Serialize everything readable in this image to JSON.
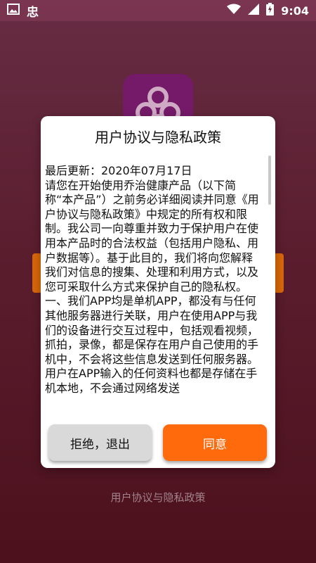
{
  "status_bar": {
    "time": "9:04",
    "carrier_glyph": "忠"
  },
  "background": {
    "bottom_link": "用户协议与隐私政策"
  },
  "dialog": {
    "title": "用户协议与隐私政策",
    "paragraphs": [
      "最后更新：2020年07月17日",
      "请您在开始使用乔治健康产品（以下简称“本产品”）之前务必详细阅读并同意《用户协议与隐私政策》中规定的所有权和限制。我公司一向尊重并致力于保护用户在使用本产品时的合法权益（包括用户隐私、用户数据等）。基于此目的，我们将向您解释我们对信息的搜集、处理和利用方式，以及您可采取什么方式来保护自己的隐私权。",
      "一、我们APP均是单机APP，都没有与任何其他服务器进行关联，用户在使用APP与我们的设备进行交互过程中，包括观看视频，抓拍，录像，都是保存在用户自己使用的手机中，不会将这些信息发送到任何服务器。用户在APP输入的任何资料也都是存储在手机本地，不会通过网络发送"
    ],
    "reject_label": "拒绝，退出",
    "agree_label": "同意"
  },
  "colors": {
    "accent": "#ff6a0d",
    "logo": "#8a1f7c"
  },
  "icons": [
    "image-icon",
    "wifi-icon",
    "signal-icon",
    "battery-icon"
  ]
}
